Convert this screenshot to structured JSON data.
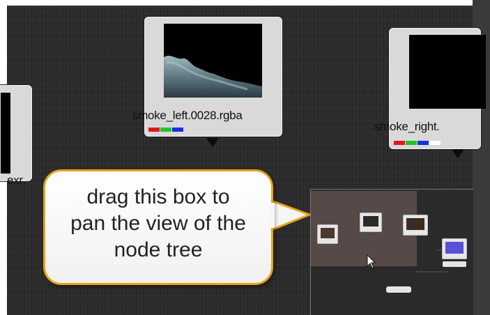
{
  "node_graph": {
    "nodes": [
      {
        "label": ".exr"
      },
      {
        "label": "smoke_left.0028.rgba",
        "channels": [
          "#e01818",
          "#22c322",
          "#1a2ee0"
        ]
      },
      {
        "label": "smoke_right.",
        "channels": [
          "#e01818",
          "#22c322",
          "#1a2ee0",
          "#ffffff"
        ]
      }
    ]
  },
  "overview": {
    "mini_nodes": 5
  },
  "callout": {
    "text": "drag this box to\npan the view of the\nnode tree"
  }
}
